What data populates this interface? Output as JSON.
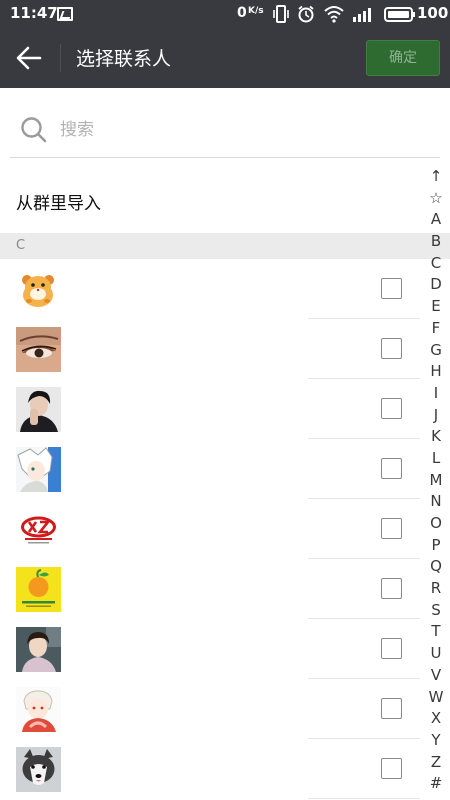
{
  "status_bar": {
    "time": "11:47",
    "net_speed": "0",
    "net_speed_unit": "K/s",
    "battery": "100",
    "icons": [
      "message-icon",
      "vibrate-icon",
      "alarm-icon",
      "wifi-icon",
      "signal-icon",
      "battery-icon"
    ]
  },
  "header": {
    "title": "选择联系人",
    "confirm_label": "确定",
    "back_icon": "arrow-left-icon"
  },
  "search": {
    "placeholder": "搜索",
    "value": ""
  },
  "import_from_group": "从群里导入",
  "section": {
    "letter": "C"
  },
  "contacts": [
    {
      "avatar": "hamster-cartoon-avatar",
      "checked": false
    },
    {
      "avatar": "eye-makeup-avatar",
      "checked": false
    },
    {
      "avatar": "dark-portrait-avatar",
      "checked": false
    },
    {
      "avatar": "anime-white-hair-avatar",
      "checked": false
    },
    {
      "avatar": "red-logo-avatar",
      "checked": false
    },
    {
      "avatar": "yellow-fruit-logo-avatar",
      "checked": false
    },
    {
      "avatar": "boy-portrait-avatar",
      "checked": false
    },
    {
      "avatar": "anime-red-avatar",
      "checked": false
    },
    {
      "avatar": "husky-dog-avatar",
      "checked": false
    }
  ],
  "index_bar": [
    "↑",
    "☆",
    "A",
    "B",
    "C",
    "D",
    "E",
    "F",
    "G",
    "H",
    "I",
    "J",
    "K",
    "L",
    "M",
    "N",
    "O",
    "P",
    "Q",
    "R",
    "S",
    "T",
    "U",
    "V",
    "W",
    "X",
    "Y",
    "Z",
    "#"
  ],
  "colors": {
    "app_bar": "#393a3f",
    "confirm_bg": "#2e6b30",
    "section_bg": "#ebebeb"
  }
}
